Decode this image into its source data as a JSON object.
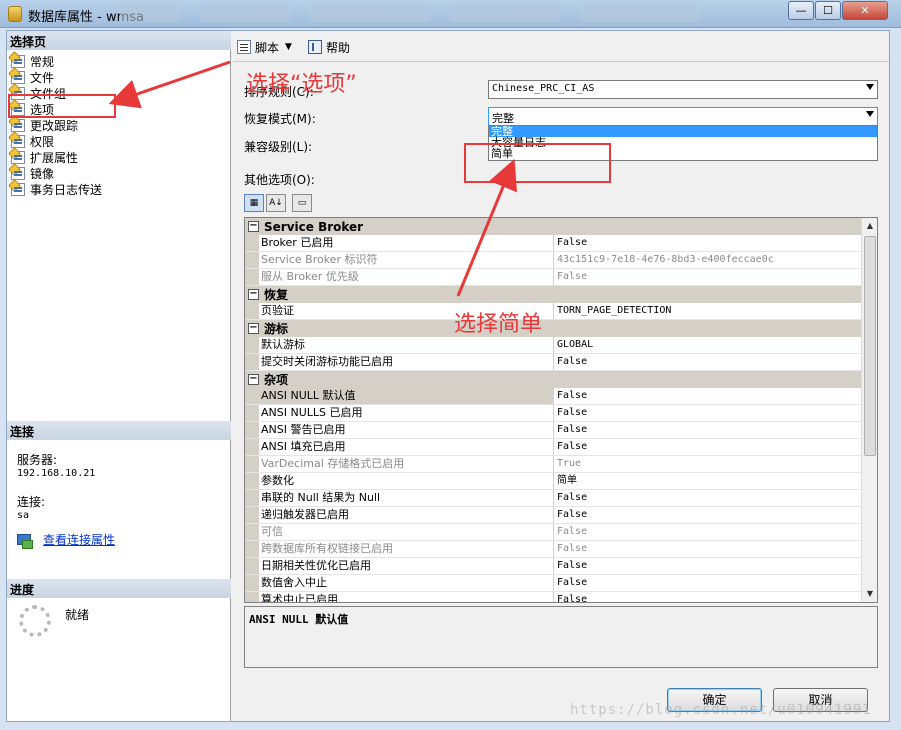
{
  "window": {
    "title": "数据库属性 - wmsa",
    "close_label": "✕",
    "min_label": "—",
    "max_label": "☐"
  },
  "left": {
    "select_page_header": "选择页",
    "pages": [
      "常规",
      "文件",
      "文件组",
      "选项",
      "更改跟踪",
      "权限",
      "扩展属性",
      "镜像",
      "事务日志传送"
    ],
    "connection_header": "连接",
    "server_label": "服务器:",
    "server_value": "192.168.10.21",
    "connection_label": "连接:",
    "connection_value": "sa",
    "view_conn_props": "查看连接属性",
    "progress_header": "进度",
    "progress_status": "就绪"
  },
  "toolbar": {
    "script": "脚本",
    "help": "帮助"
  },
  "form": {
    "collation_label": "排序规则(C):",
    "collation_value": "Chinese_PRC_CI_AS",
    "recovery_label": "恢复模式(M):",
    "recovery_value": "完整",
    "recovery_options": [
      "完整",
      "大容量日志",
      "简单"
    ],
    "compat_label": "兼容级别(L):",
    "other_label": "其他选项(O):"
  },
  "grid": {
    "categories": [
      {
        "name": "Service Broker",
        "rows": [
          {
            "name": "Broker 已启用",
            "value": "False",
            "disabled": false
          },
          {
            "name": "Service Broker 标识符",
            "value": "43c151c9-7e18-4e76-8bd3-e400feccae0c",
            "disabled": true
          },
          {
            "name": "服从 Broker 优先级",
            "value": "False",
            "disabled": true
          }
        ]
      },
      {
        "name": "恢复",
        "rows": [
          {
            "name": "页验证",
            "value": "TORN_PAGE_DETECTION",
            "disabled": false
          }
        ]
      },
      {
        "name": "游标",
        "rows": [
          {
            "name": "默认游标",
            "value": "GLOBAL",
            "disabled": false
          },
          {
            "name": "提交时关闭游标功能已启用",
            "value": "False",
            "disabled": false
          }
        ]
      },
      {
        "name": "杂项",
        "rows": [
          {
            "name": "ANSI NULL 默认值",
            "value": "False",
            "disabled": false,
            "selected": true
          },
          {
            "name": "ANSI NULLS 已启用",
            "value": "False",
            "disabled": false
          },
          {
            "name": "ANSI 警告已启用",
            "value": "False",
            "disabled": false
          },
          {
            "name": "ANSI 填充已启用",
            "value": "False",
            "disabled": false
          },
          {
            "name": "VarDecimal 存储格式已启用",
            "value": "True",
            "disabled": true
          },
          {
            "name": "参数化",
            "value": "简单",
            "disabled": false
          },
          {
            "name": "串联的 Null 结果为 Null",
            "value": "False",
            "disabled": false
          },
          {
            "name": "递归触发器已启用",
            "value": "False",
            "disabled": false
          },
          {
            "name": "可信",
            "value": "False",
            "disabled": true
          },
          {
            "name": "跨数据库所有权链接已启用",
            "value": "False",
            "disabled": true
          },
          {
            "name": "日期相关性优化已启用",
            "value": "False",
            "disabled": false
          },
          {
            "name": "数值舍入中止",
            "value": "False",
            "disabled": false
          },
          {
            "name": "算术中止已启用",
            "value": "False",
            "disabled": false
          }
        ]
      }
    ]
  },
  "description": {
    "title": "ANSI NULL 默认值"
  },
  "buttons": {
    "ok": "确定",
    "cancel": "取消"
  },
  "annotations": {
    "select_options": "选择“选项”",
    "select_simple": "选择简单"
  },
  "watermark": "https://blog.csdn.net/u010941991",
  "colors": {
    "annotation": "#e8393a",
    "selection": "#3399ff"
  }
}
